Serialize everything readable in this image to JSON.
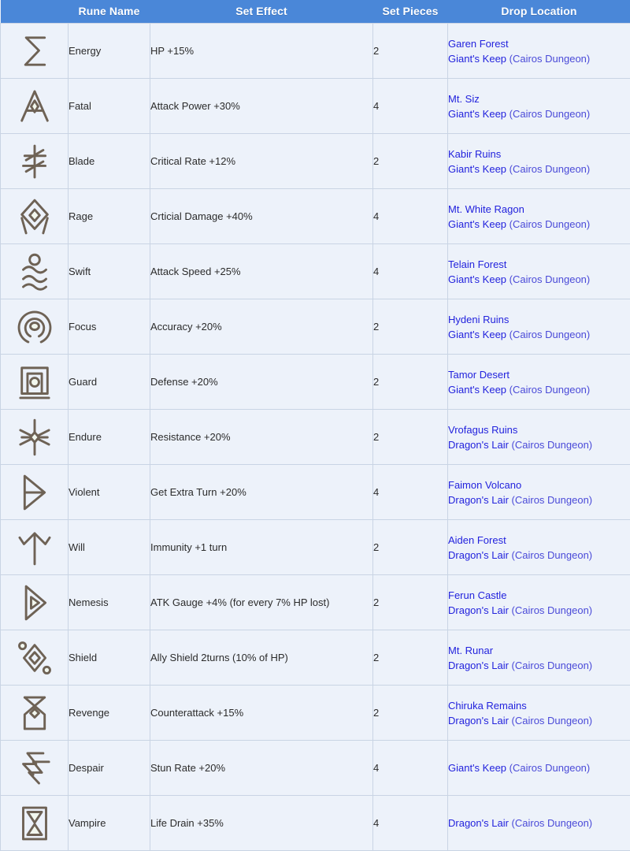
{
  "table": {
    "columns": [
      {
        "key": "icon",
        "label": ""
      },
      {
        "key": "name",
        "label": "Rune Name"
      },
      {
        "key": "effect",
        "label": "Set Effect"
      },
      {
        "key": "pieces",
        "label": "Set Pieces"
      },
      {
        "key": "drop",
        "label": "Drop Location"
      }
    ],
    "header_bg": "#4a87d8",
    "header_text_color": "#ffffff",
    "row_bg": "#edf2fa",
    "border_color": "#c9d4e4",
    "link_color": "#2222dd",
    "rows": [
      {
        "icon": "rune-energy-icon",
        "name": "Energy",
        "effect": "HP +15%",
        "pieces": "2",
        "drop": [
          "Garen Forest",
          "Giant's Keep (Cairos Dungeon)"
        ]
      },
      {
        "icon": "rune-fatal-icon",
        "name": "Fatal",
        "effect": "Attack Power +30%",
        "pieces": "4",
        "drop": [
          "Mt. Siz",
          "Giant's Keep (Cairos Dungeon)"
        ]
      },
      {
        "icon": "rune-blade-icon",
        "name": "Blade",
        "effect": "Critical Rate +12%",
        "pieces": "2",
        "drop": [
          "Kabir Ruins",
          "Giant's Keep (Cairos Dungeon)"
        ]
      },
      {
        "icon": "rune-rage-icon",
        "name": "Rage",
        "effect": "Crticial Damage +40%",
        "pieces": "4",
        "drop": [
          "Mt. White Ragon",
          "Giant's Keep (Cairos Dungeon)"
        ]
      },
      {
        "icon": "rune-swift-icon",
        "name": "Swift",
        "effect": "Attack Speed +25%",
        "pieces": "4",
        "drop": [
          "Telain Forest",
          "Giant's Keep (Cairos Dungeon)"
        ]
      },
      {
        "icon": "rune-focus-icon",
        "name": "Focus",
        "effect": "Accuracy +20%",
        "pieces": "2",
        "drop": [
          "Hydeni Ruins",
          "Giant's Keep (Cairos Dungeon)"
        ]
      },
      {
        "icon": "rune-guard-icon",
        "name": "Guard",
        "effect": "Defense +20%",
        "pieces": "2",
        "drop": [
          "Tamor Desert",
          "Giant's Keep (Cairos Dungeon)"
        ]
      },
      {
        "icon": "rune-endure-icon",
        "name": "Endure",
        "effect": "Resistance +20%",
        "pieces": "2",
        "drop": [
          "Vrofagus Ruins",
          "Dragon's Lair (Cairos Dungeon)"
        ]
      },
      {
        "icon": "rune-violent-icon",
        "name": "Violent",
        "effect": "Get Extra Turn +20%",
        "pieces": "4",
        "drop": [
          "Faimon Volcano",
          "Dragon's Lair (Cairos Dungeon)"
        ]
      },
      {
        "icon": "rune-will-icon",
        "name": "Will",
        "effect": "Immunity +1 turn",
        "pieces": "2",
        "drop": [
          "Aiden Forest",
          "Dragon's Lair (Cairos Dungeon)"
        ]
      },
      {
        "icon": "rune-nemesis-icon",
        "name": "Nemesis",
        "effect": "ATK Gauge +4% (for every 7% HP lost)",
        "pieces": "2",
        "drop": [
          "Ferun Castle",
          "Dragon's Lair (Cairos Dungeon)"
        ]
      },
      {
        "icon": "rune-shield-icon",
        "name": "Shield",
        "effect": "Ally Shield 2turns (10% of HP)",
        "pieces": "2",
        "drop": [
          "Mt. Runar",
          "Dragon's Lair (Cairos Dungeon)"
        ]
      },
      {
        "icon": "rune-revenge-icon",
        "name": "Revenge",
        "effect": "Counterattack +15%",
        "pieces": "2",
        "drop": [
          "Chiruka Remains",
          "Dragon's Lair (Cairos Dungeon)"
        ]
      },
      {
        "icon": "rune-despair-icon",
        "name": "Despair",
        "effect": "Stun Rate +20%",
        "pieces": "4",
        "drop": [
          "Giant's Keep (Cairos Dungeon)"
        ]
      },
      {
        "icon": "rune-vampire-icon",
        "name": "Vampire",
        "effect": "Life Drain +35%",
        "pieces": "4",
        "drop": [
          "Dragon's Lair (Cairos Dungeon)"
        ]
      }
    ]
  }
}
